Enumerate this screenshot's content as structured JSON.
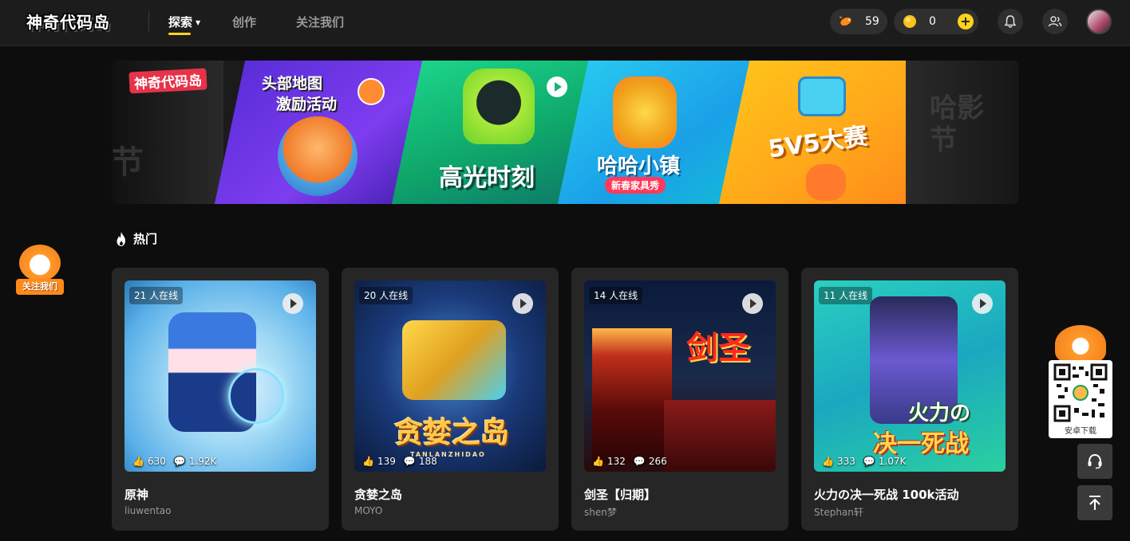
{
  "header": {
    "logo_text": "神奇代码岛",
    "nav": [
      {
        "label": "探索",
        "active": true
      },
      {
        "label": "创作",
        "active": false
      },
      {
        "label": "关注我们",
        "active": false
      }
    ],
    "fish_count": "59",
    "coin_count": "0"
  },
  "banner": {
    "logo_text": "神奇代码岛",
    "panels": [
      {
        "line1": "头部地图",
        "line2": "激励活动"
      },
      {
        "title": "高光时刻"
      },
      {
        "title": "哈哈小镇",
        "subtitle": "新春家具秀"
      },
      {
        "title": "5V5大赛"
      }
    ],
    "side_text_left": "节",
    "side_text_right": "哈影节"
  },
  "section": {
    "title": "热门"
  },
  "follow_float_label": "关注我们",
  "cards": [
    {
      "online": "21 人在线",
      "likes": "630",
      "comments": "1.92K",
      "title": "原神",
      "author": "liuwentao"
    },
    {
      "online": "20 人在线",
      "likes": "139",
      "comments": "188",
      "title": "贪婪之岛",
      "author": "MOYO",
      "art_text": "贪婪之岛",
      "art_sub": "TANLANZHIDAO"
    },
    {
      "online": "14 人在线",
      "likes": "132",
      "comments": "266",
      "title": "剑圣【归期】",
      "author": "shen梦",
      "art_text": "剑圣"
    },
    {
      "online": "11 人在线",
      "likes": "333",
      "comments": "1.07K",
      "title": "火力の决一死战 100k活动",
      "author": "Stephan轩",
      "art_text1": "火力の",
      "art_text2": "决一死战"
    }
  ],
  "right_float": {
    "qr_label": "安卓下载"
  }
}
